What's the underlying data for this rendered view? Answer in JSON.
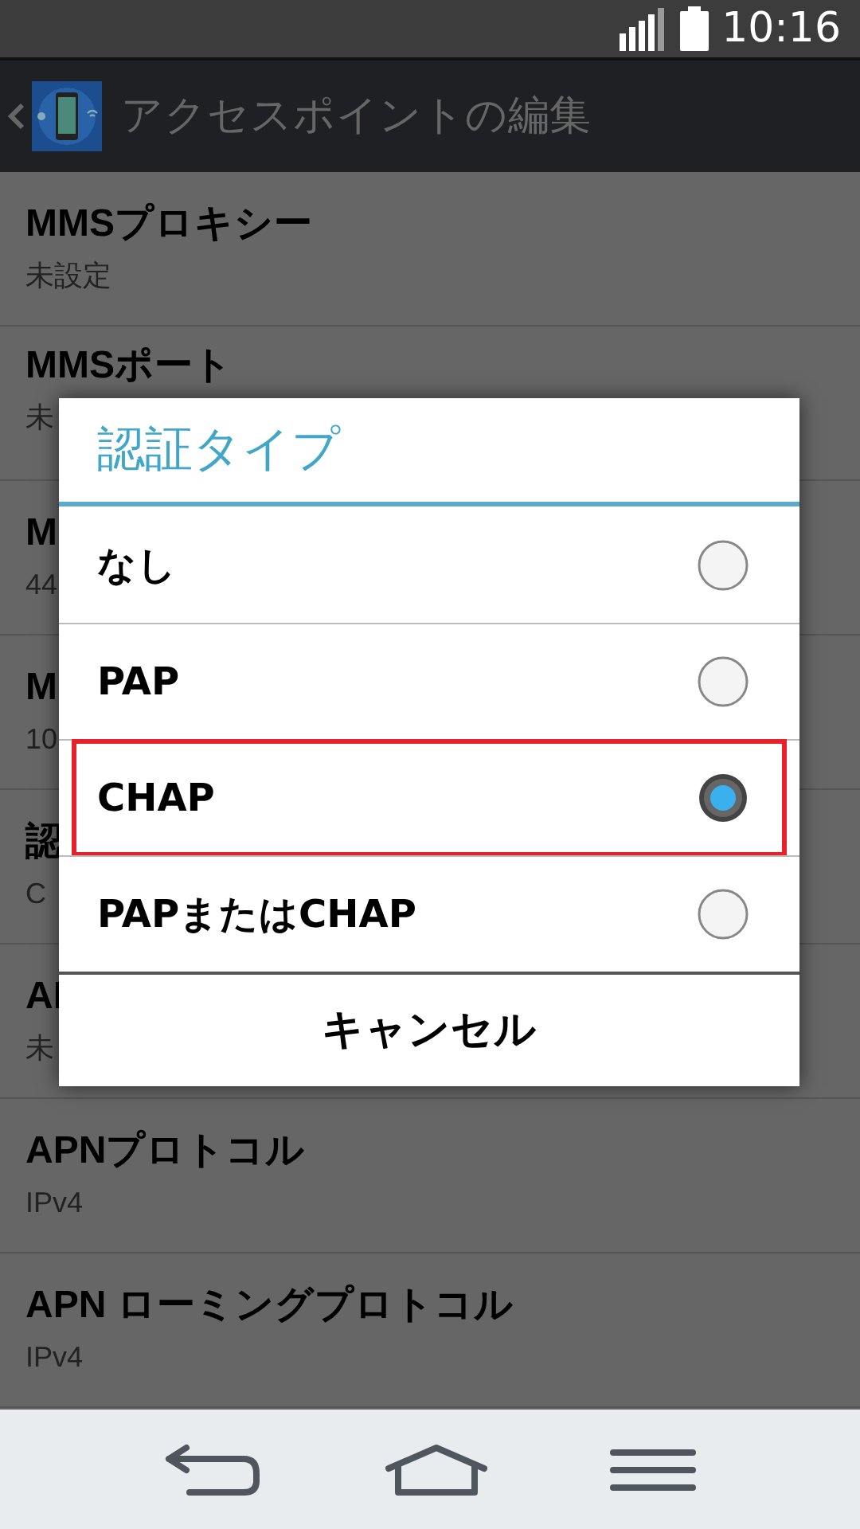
{
  "status_bar": {
    "time": "10:16"
  },
  "action_bar": {
    "title": "アクセスポイントの編集"
  },
  "settings": [
    {
      "title": "MMSプロキシー",
      "value": "未設定"
    },
    {
      "title": "MMSポート",
      "value": "未"
    },
    {
      "title": "M",
      "value": "44"
    },
    {
      "title": "M",
      "value": "10"
    },
    {
      "title": "認",
      "value": "C"
    },
    {
      "title": "AI",
      "value": "未"
    },
    {
      "title": "APNプロトコル",
      "value": "IPv4"
    },
    {
      "title": "APN ローミングプロトコル",
      "value": "IPv4"
    }
  ],
  "dialog": {
    "title": "認証タイプ",
    "options": [
      {
        "label": "なし",
        "selected": false,
        "highlighted": false
      },
      {
        "label": "PAP",
        "selected": false,
        "highlighted": false
      },
      {
        "label": "CHAP",
        "selected": true,
        "highlighted": true
      },
      {
        "label": "PAPまたはCHAP",
        "selected": false,
        "highlighted": false
      }
    ],
    "cancel": "キャンセル"
  }
}
